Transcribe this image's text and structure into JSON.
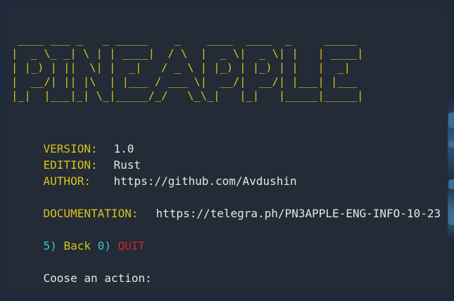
{
  "banner": {
    "ascii": " ____ ___ _   _ _____    _    ____  ____  _     _____\n|  _ \\_ _| \\ | | ____|  / \\  |  _ \\|  _ \\| |   | ____|\n| |_) | ||  \\| |  _|   / _ \\ | |_) | |_) | |   |  _|\n|  __/| || |\\  | |___ / ___ \\|  __/|  __/| |___| |___\n|_|  |___|_| \\_|_____/_/   \\_\\_|   |_|   |_____|_____|"
  },
  "info": {
    "version_label": "VERSION:",
    "version_value": "1.0",
    "edition_label": "EDITION:",
    "edition_value": "Rust",
    "author_label": "AUTHOR:",
    "author_value": "https://github.com/Avdushin",
    "docs_label": "DOCUMENTATION:",
    "docs_value": "https://telegra.ph/PN3APPLE-ENG-INFO-10-23"
  },
  "menu": {
    "back_key": "5)",
    "back_label": "Back",
    "quit_key": "0)",
    "quit_label": "QUIT"
  },
  "prompt": {
    "text": "Coose an action:"
  },
  "colors": {
    "terminal_bg": "#222b36",
    "banner": "#d9c21a",
    "label": "#d9c21a",
    "text": "#e6e6e6",
    "key": "#39c5cf",
    "quit": "#d62626"
  }
}
